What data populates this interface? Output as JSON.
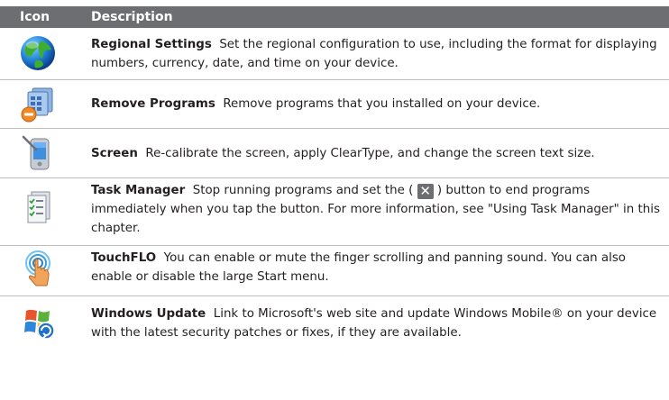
{
  "header": {
    "icon_col": "Icon",
    "desc_col": "Description"
  },
  "rows": [
    {
      "icon": "globe-icon",
      "name": "Regional Settings",
      "desc": "Set the regional configuration to use, including the format for displaying numbers, currency, date, and time on your device."
    },
    {
      "icon": "remove-programs-icon",
      "name": "Remove Programs",
      "desc": "Remove programs that you installed on your device."
    },
    {
      "icon": "screen-stylus-icon",
      "name": "Screen",
      "desc": "Re-calibrate the screen, apply ClearType, and change the screen text size."
    },
    {
      "icon": "task-manager-icon",
      "name": "Task Manager",
      "desc_before": "Stop running programs and set the (",
      "button_glyph": "✕",
      "desc_after": ") button to end programs immediately when you tap the button. For more information, see \"Using Task Manager\" in this chapter."
    },
    {
      "icon": "touchflo-icon",
      "name": "TouchFLO",
      "desc": "You can enable or mute the finger scrolling and panning sound. You can also enable or disable the large Start menu."
    },
    {
      "icon": "windows-update-icon",
      "name": "Windows Update",
      "desc": "Link to Microsoft's web site and update Windows Mobile® on your device with the latest security patches or fixes, if they are available."
    }
  ],
  "colors": {
    "header_bg": "#6d6e71",
    "divider": "#bcbec0",
    "text": "#231f20"
  }
}
